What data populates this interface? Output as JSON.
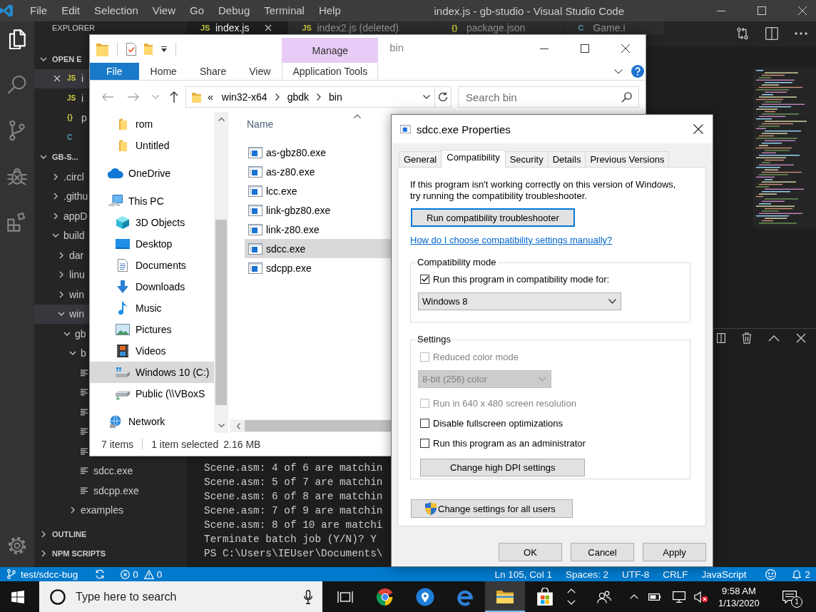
{
  "vscode": {
    "title": "index.js - gb-studio - Visual Studio Code",
    "menu": [
      "File",
      "Edit",
      "Selection",
      "View",
      "Go",
      "Debug",
      "Terminal",
      "Help"
    ],
    "activity_bar": [
      {
        "kind": "files",
        "selected": true
      },
      {
        "kind": "search",
        "selected": false
      },
      {
        "kind": "source-control",
        "selected": false
      },
      {
        "kind": "debug",
        "selected": false
      },
      {
        "kind": "extensions",
        "selected": false
      }
    ],
    "sidebar": {
      "title": "EXPLORER",
      "open_editors": {
        "header": "OPEN E",
        "expanded": true,
        "items": [
          {
            "kind": "js",
            "icon": "JS",
            "name": "i",
            "selected": true
          },
          {
            "kind": "js",
            "icon": "JS",
            "name": "i",
            "selected": false
          },
          {
            "kind": "json",
            "icon": "{}",
            "name": "p",
            "selected": false
          },
          {
            "kind": "c",
            "icon": "C",
            "selected": false
          }
        ]
      },
      "folder": {
        "header": "GB-S...",
        "expanded": true,
        "tree": [
          {
            "kind": "folder",
            "label": ".circl",
            "expanded": false,
            "selected": false
          },
          {
            "kind": "folder",
            "label": ".githu",
            "expanded": false,
            "selected": false
          },
          {
            "kind": "folder",
            "label": "appD",
            "expanded": false,
            "selected": false
          },
          {
            "kind": "folder",
            "label": "build",
            "expanded": true,
            "selected": false,
            "children": [
              {
                "kind": "folder",
                "label": "dar",
                "expanded": false,
                "selected": false
              },
              {
                "kind": "folder",
                "label": "linu",
                "expanded": false,
                "selected": false
              },
              {
                "kind": "folder",
                "label": "win",
                "expanded": false,
                "selected": false
              },
              {
                "kind": "folder",
                "label": "win",
                "expanded": true,
                "selected": true,
                "children": [
                  {
                    "kind": "folder",
                    "label": "gb",
                    "expanded": true,
                    "selected": false,
                    "children": [
                      {
                        "kind": "folder",
                        "label": "b",
                        "expanded": true,
                        "selected": false,
                        "children": [
                          {
                            "kind": "file",
                            "selected": false
                          },
                          {
                            "kind": "file",
                            "selected": false
                          },
                          {
                            "kind": "file",
                            "selected": false
                          },
                          {
                            "kind": "file",
                            "selected": false
                          },
                          {
                            "kind": "file",
                            "selected": false
                          },
                          {
                            "kind": "file",
                            "label": "sdcc.exe",
                            "selected": false
                          },
                          {
                            "kind": "file",
                            "label": "sdcpp.exe",
                            "selected": false
                          }
                        ]
                      },
                      {
                        "kind": "folder",
                        "label": "examples",
                        "expanded": false,
                        "selected": false
                      }
                    ]
                  }
                ]
              }
            ]
          }
        ]
      },
      "more_sections": [
        {
          "header": "OUTLINE",
          "expanded": false
        },
        {
          "header": "NPM SCRIPTS",
          "expanded": false
        }
      ]
    },
    "tabs": [
      {
        "kind": "js",
        "icon": "JS",
        "label": "index.js",
        "selected": true
      },
      {
        "kind": "js",
        "icon": "JS",
        "label": "index2.js (deleted)",
        "selected": false
      },
      {
        "kind": "json",
        "icon": "{}",
        "label": "package.json",
        "selected": false
      },
      {
        "kind": "c",
        "icon": "C",
        "label": "Game.i",
        "selected": false
      }
    ],
    "terminal": {
      "lines": [
        "Scene.asm: 4 of 6 are matchin",
        "Scene.asm: 5 of 7 are matchin",
        "Scene.asm: 6 of 8 are matchin",
        "Scene.asm: 7 of 9 are matchin",
        "Scene.asm: 8 of 10 are matchi",
        "Terminate batch job (Y/N)? Y",
        "PS C:\\Users\\IEUser\\Documents\\"
      ]
    },
    "status_bar": {
      "branch": "test/sdcc-bug",
      "errors": "0",
      "warnings": "0",
      "items": [
        "Ln 105, Col 1",
        "Spaces: 2",
        "UTF-8",
        "CRLF",
        "JavaScript"
      ],
      "notifications": "2"
    }
  },
  "file_explorer": {
    "title": "bin",
    "ribbon_tabs": [
      {
        "label": "File",
        "kind": "file"
      },
      {
        "label": "Home",
        "kind": "plain"
      },
      {
        "label": "Share",
        "kind": "plain"
      },
      {
        "label": "View",
        "kind": "plain"
      },
      {
        "label": "Application Tools",
        "kind": "contextual",
        "group": "Manage"
      }
    ],
    "address": {
      "overflow": "«",
      "path": [
        "win32-x64",
        "gbdk",
        "bin"
      ]
    },
    "search": {
      "placeholder": "Search bin"
    },
    "nav_pane": {
      "items": [
        {
          "children": [
            {
              "label": "rom",
              "kind": "folder",
              "selected": false
            },
            {
              "label": "Untitled",
              "kind": "folder",
              "selected": false
            }
          ]
        },
        {
          "label": "OneDrive",
          "kind": "cloud",
          "selected": false
        },
        {
          "label": "This PC",
          "kind": "pc",
          "selected": false,
          "children": [
            {
              "label": "3D Objects",
              "kind": "cube",
              "selected": false
            },
            {
              "label": "Desktop",
              "kind": "desktop",
              "selected": false
            },
            {
              "label": "Documents",
              "kind": "documents",
              "selected": false
            },
            {
              "label": "Downloads",
              "kind": "downloads",
              "selected": false
            },
            {
              "label": "Music",
              "kind": "music",
              "selected": false
            },
            {
              "label": "Pictures",
              "kind": "pictures",
              "selected": false
            },
            {
              "label": "Videos",
              "kind": "videos",
              "selected": false
            },
            {
              "label": "Windows 10 (C:)",
              "kind": "drive",
              "selected": true
            },
            {
              "label": "Public (\\\\VBoxS",
              "kind": "network-drive",
              "selected": false
            }
          ]
        },
        {
          "label": "Network",
          "kind": "network",
          "selected": false
        }
      ]
    },
    "column": {
      "label": "Name",
      "sort_ascending": true
    },
    "files": [
      {
        "name": "as-gbz80.exe",
        "selected": false
      },
      {
        "name": "as-z80.exe",
        "selected": false
      },
      {
        "name": "lcc.exe",
        "selected": false
      },
      {
        "name": "link-gbz80.exe",
        "selected": false
      },
      {
        "name": "link-z80.exe",
        "selected": false
      },
      {
        "name": "sdcc.exe",
        "selected": true
      },
      {
        "name": "sdcpp.exe",
        "selected": false
      }
    ],
    "status": {
      "count": "7 items",
      "selection": "1 item selected",
      "size": "2.16 MB"
    }
  },
  "properties_dialog": {
    "title": "sdcc.exe Properties",
    "tabs": [
      {
        "label": "General",
        "selected": false
      },
      {
        "label": "Compatibility",
        "selected": true
      },
      {
        "label": "Security",
        "selected": false
      },
      {
        "label": "Details",
        "selected": false
      },
      {
        "label": "Previous Versions",
        "selected": false
      }
    ],
    "intro": "If this program isn't working correctly on this version of Windows, try running the compatibility troubleshooter.",
    "troubleshooter_button": {
      "label": "Run compatibility troubleshooter",
      "focused": true
    },
    "help_link": "How do I choose compatibility settings manually?",
    "groups": [
      {
        "title": "Compatibility mode",
        "controls": [
          {
            "kind": "checkbox",
            "label": "Run this program in compatibility mode for:",
            "checked": true,
            "disabled": false
          },
          {
            "kind": "dropdown",
            "value": "Windows 8",
            "disabled": false
          }
        ]
      },
      {
        "title": "Settings",
        "controls": [
          {
            "kind": "checkbox",
            "label": "Reduced color mode",
            "checked": false,
            "disabled": true
          },
          {
            "kind": "dropdown",
            "value": "8-bit (256) color",
            "disabled": true
          },
          {
            "kind": "checkbox",
            "label": "Run in 640 x 480 screen resolution",
            "checked": false,
            "disabled": true
          },
          {
            "kind": "checkbox",
            "label": "Disable fullscreen optimizations",
            "checked": false,
            "disabled": false
          },
          {
            "kind": "checkbox",
            "label": "Run this program as an administrator",
            "checked": false,
            "disabled": false
          },
          {
            "kind": "button",
            "label": "Change high DPI settings",
            "disabled": false
          }
        ]
      }
    ],
    "all_users_button": {
      "label": "Change settings for all users",
      "shield": true
    },
    "buttons": [
      {
        "label": "OK"
      },
      {
        "label": "Cancel"
      },
      {
        "label": "Apply"
      }
    ]
  },
  "taskbar": {
    "search": {
      "placeholder": "Type here to search"
    },
    "apps": [
      {
        "kind": "task-view",
        "active": false
      },
      {
        "kind": "browser",
        "active": false
      },
      {
        "kind": "pin",
        "active": false
      },
      {
        "kind": "edge",
        "active": false
      },
      {
        "kind": "explorer",
        "active": true
      },
      {
        "kind": "store",
        "active": false
      }
    ],
    "clock": {
      "time": "9:58 AM",
      "date": "1/13/2020"
    },
    "notifications": "1"
  }
}
